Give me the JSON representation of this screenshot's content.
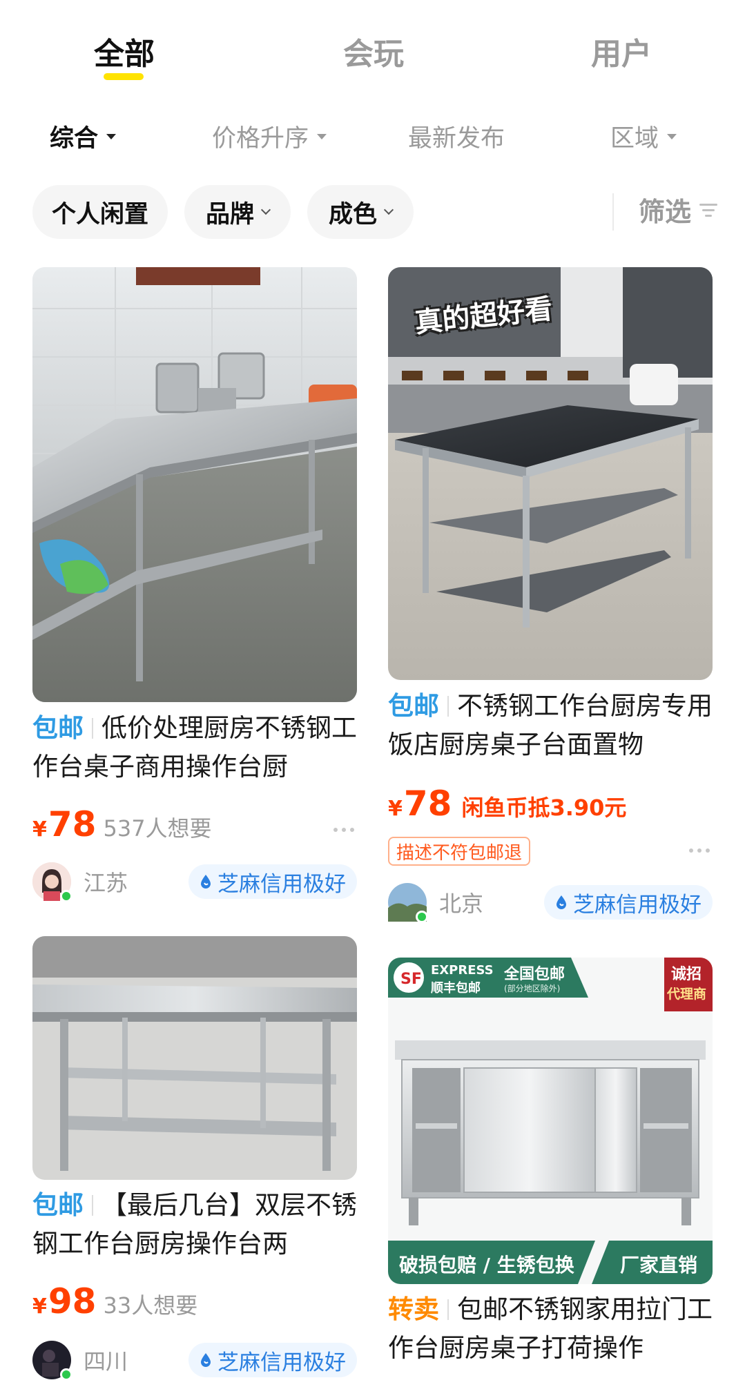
{
  "tabs": [
    {
      "label": "全部",
      "active": true
    },
    {
      "label": "会玩",
      "active": false
    },
    {
      "label": "用户",
      "active": false
    }
  ],
  "sort": [
    {
      "label": "综合",
      "active": true
    },
    {
      "label": "价格升序",
      "active": false
    },
    {
      "label": "最新发布",
      "active": false
    },
    {
      "label": "区域",
      "active": false
    }
  ],
  "chips": [
    {
      "label": "个人闲置"
    },
    {
      "label": "品牌"
    },
    {
      "label": "成色"
    }
  ],
  "filter_label": "筛选",
  "products": [
    {
      "tag": "包邮",
      "title": "低价处理厨房不锈钢工作台桌子商用操作台厨",
      "currency": "¥",
      "price": "78",
      "want": "537人想要",
      "location": "江苏",
      "credit": "芝麻信用极好",
      "avatar_icon": "avatar-girl-icon"
    },
    {
      "image_sticker": "真的超好看",
      "tag": "包邮",
      "title": "不锈钢工作台厨房专用饭店厨房桌子台面置物",
      "currency": "¥",
      "price": "78",
      "coin": "闲鱼币抵3.90元",
      "desc_tag": "描述不符包邮退",
      "location": "北京",
      "credit": "芝麻信用极好",
      "avatar_icon": "avatar-landscape-icon"
    },
    {
      "tag": "包邮",
      "title": "【最后几台】双层不锈钢工作台厨房操作台两",
      "currency": "¥",
      "price": "98",
      "want": "33人想要",
      "location": "四川",
      "credit": "芝麻信用极好",
      "avatar_icon": "avatar-night-icon"
    },
    {
      "image_banner": {
        "express": "EXPRESS",
        "sf_name": "顺丰包邮",
        "nationwide": "全国包邮",
        "nationwide_note": "(部分地区除外)",
        "recruit_1": "诚招",
        "recruit_2": "代理商",
        "bottom_left": "破损包赔 / 生锈包换",
        "bottom_right": "厂家直销"
      },
      "tag": "转卖",
      "title": "包邮不锈钢家用拉门工作台厨房桌子打荷操作"
    }
  ],
  "colors": {
    "accent_yellow": "#ffe300",
    "price_red": "#ff4000",
    "free_ship_blue": "#2f9be3",
    "resell_orange": "#ff8a00",
    "credit_blue": "#2a7fe0"
  }
}
